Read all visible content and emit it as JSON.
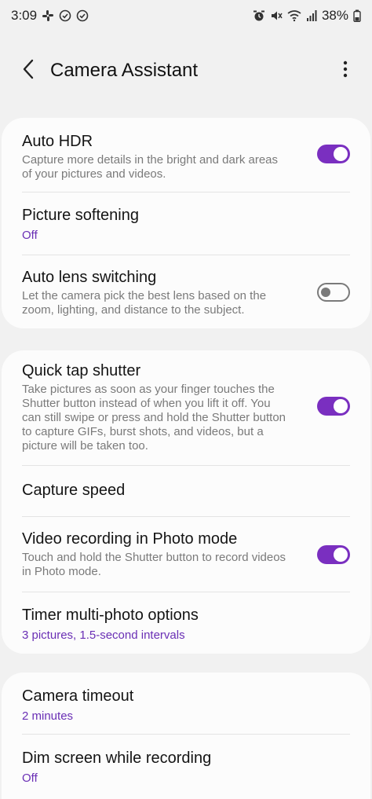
{
  "status_bar": {
    "time": "3:09",
    "battery": "38%",
    "left_icons": [
      "slack-icon",
      "check-circle-icon",
      "check-circle-icon"
    ],
    "right_icons": [
      "alarm-icon",
      "mute-icon",
      "wifi-icon",
      "signal-icon"
    ]
  },
  "header": {
    "title": "Camera Assistant",
    "back_icon": "chevron-left-icon",
    "more_icon": "more-vertical-icon"
  },
  "accent_color": "#7a2fc0",
  "sections": [
    {
      "items": [
        {
          "title": "Auto HDR",
          "subtitle": "Capture more details in the bright and dark areas of your pictures and videos.",
          "toggle": "on"
        },
        {
          "title": "Picture softening",
          "value": "Off"
        },
        {
          "title": "Auto lens switching",
          "subtitle": "Let the camera pick the best lens based on the zoom, lighting, and distance to the subject.",
          "toggle": "off"
        }
      ]
    },
    {
      "items": [
        {
          "title": "Quick tap shutter",
          "subtitle": "Take pictures as soon as your finger touches the Shutter button instead of when you lift it off. You can still swipe or press and hold the Shutter button to capture GIFs, burst shots, and videos, but a picture will be taken too.",
          "toggle": "on"
        },
        {
          "title": "Capture speed"
        },
        {
          "title": "Video recording in Photo mode",
          "subtitle": "Touch and hold the Shutter button to record videos in Photo mode.",
          "toggle": "on"
        },
        {
          "title": "Timer multi-photo options",
          "value": "3 pictures, 1.5-second intervals"
        }
      ]
    },
    {
      "items": [
        {
          "title": "Camera timeout",
          "value": "2 minutes"
        },
        {
          "title": "Dim screen while recording",
          "value": "Off"
        }
      ]
    }
  ]
}
